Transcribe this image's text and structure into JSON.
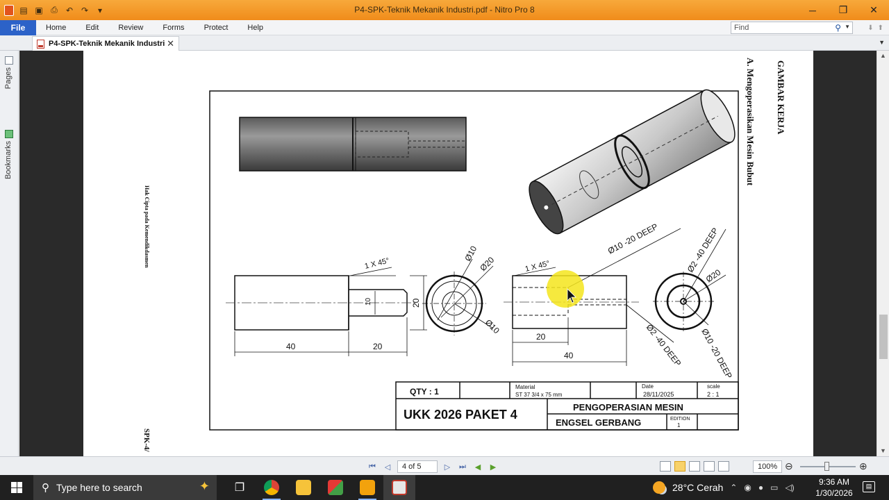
{
  "window": {
    "title": "P4-SPK-Teknik Mekanik Industri.pdf - Nitro Pro 8",
    "controls": {
      "minimize": "─",
      "restore": "❐",
      "close": "✕"
    }
  },
  "menu": {
    "file": "File",
    "items": [
      "Home",
      "Edit",
      "Review",
      "Forms",
      "Protect",
      "Help"
    ],
    "find_placeholder": "Find"
  },
  "document_tab": {
    "label": "P4-SPK-Teknik Mekanik Industri",
    "close": "✕"
  },
  "side_panel": {
    "pages": "Pages",
    "bookmarks": "Bookmarks"
  },
  "page": {
    "side_title": "GAMBAR KERJA",
    "section_heading": "A.  Mengoperasikan Mesin Bubut",
    "left_margin_text": "Hak Cipta pada Kemendikdasmen",
    "footer_fragment": "SPK-4/",
    "drawing": {
      "chamfer_left": "1 X 45°",
      "chamfer_right": "1 X 45°",
      "dim_10": "10",
      "dim_20_height": "20",
      "dim_40_left": "40",
      "dim_20_left": "20",
      "dim_20_right": "20",
      "dim_40_right": "40",
      "dia_10_a": "Ø10",
      "dia_20_a": "Ø20",
      "dia_10_b": "Ø10",
      "dia_10_deep": "Ø10 -20 DEEP",
      "dia_2_deep_a": "Ø2 -40 DEEP",
      "dia_20_b": "Ø20",
      "dia_2_deep_b": "Ø2 -40 DEEP",
      "dia_10_deep_b": "Ø10 -20 DEEP"
    },
    "title_block": {
      "qty": "QTY : 1",
      "material_label": "Material",
      "material_value": "ST 37 3/4 x 75 mm",
      "date_label": "Date",
      "date_value": "28/11/2025",
      "scale_label": "scale",
      "scale_value": "2 : 1",
      "project": "UKK 2026 PAKET 4",
      "job_title": "PENGOPERASIAN MESIN",
      "part_name": "ENGSEL GERBANG",
      "edition_label": "EDITION",
      "edition_value": "1"
    }
  },
  "status": {
    "page_indicator": "4 of 5",
    "zoom": "100%"
  },
  "taskbar": {
    "search_placeholder": "Type here to search",
    "weather": "28°C  Cerah",
    "time": "9:36 AM",
    "date": "1/30/2026"
  }
}
